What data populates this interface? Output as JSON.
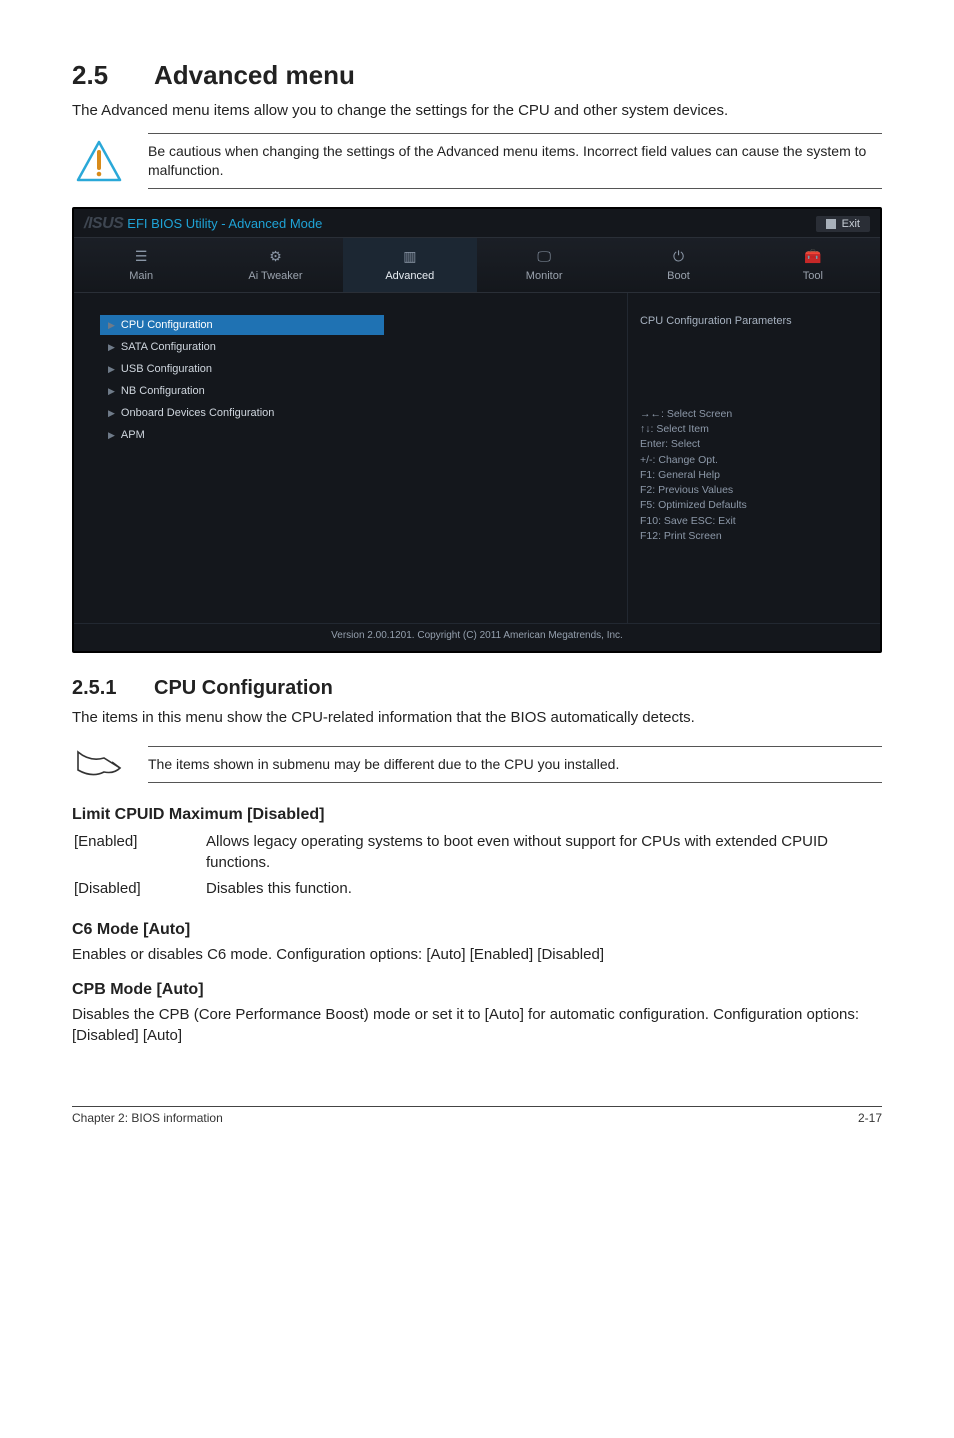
{
  "section": {
    "number": "2.5",
    "title": "Advanced menu"
  },
  "intro": "The Advanced menu items allow you to change the settings for the CPU and other system devices.",
  "caution": "Be cautious when changing the settings of the Advanced menu items. Incorrect field values can cause the system to malfunction.",
  "bios": {
    "logo": "/ISUS",
    "title": "EFI BIOS Utility - Advanced Mode",
    "exit": "Exit",
    "tabs": {
      "main": "Main",
      "ai": "Ai Tweaker",
      "advanced": "Advanced",
      "monitor": "Monitor",
      "boot": "Boot",
      "tool": "Tool"
    },
    "menu": {
      "cpu": "CPU Configuration",
      "sata": "SATA Configuration",
      "usb": "USB Configuration",
      "nb": "NB Configuration",
      "onboard": "Onboard Devices Configuration",
      "apm": "APM"
    },
    "help_title": "CPU Configuration Parameters",
    "keys": {
      "k1": "→←: Select Screen",
      "k2": "↑↓: Select Item",
      "k3": "Enter: Select",
      "k4": "+/-: Change Opt.",
      "k5": "F1: General Help",
      "k6": "F2: Previous Values",
      "k7": "F5: Optimized Defaults",
      "k8": "F10: Save   ESC: Exit",
      "k9": "F12: Print Screen"
    },
    "footer": "Version 2.00.1201.  Copyright (C) 2011 American Megatrends, Inc."
  },
  "sub": {
    "number": "2.5.1",
    "title": "CPU Configuration"
  },
  "sub_intro": "The items in this menu show the CPU-related information that the BIOS automatically detects.",
  "note": "The items shown in submenu may be different due to the CPU you installed.",
  "items": {
    "limit": {
      "heading": "Limit CPUID Maximum [Disabled]",
      "enabled_key": "[Enabled]",
      "enabled_val": "Allows legacy operating systems to boot even without support for CPUs with extended CPUID functions.",
      "disabled_key": "[Disabled]",
      "disabled_val": "Disables this function."
    },
    "c6": {
      "heading": "C6 Mode [Auto]",
      "body": "Enables or disables C6 mode. Configuration options: [Auto] [Enabled] [Disabled]"
    },
    "cpb": {
      "heading": "CPB Mode [Auto]",
      "body": "Disables the CPB (Core Performance Boost) mode or set it to [Auto] for automatic configuration. Configuration options: [Disabled] [Auto]"
    }
  },
  "footer": {
    "left": "Chapter 2: BIOS information",
    "right": "2-17"
  }
}
